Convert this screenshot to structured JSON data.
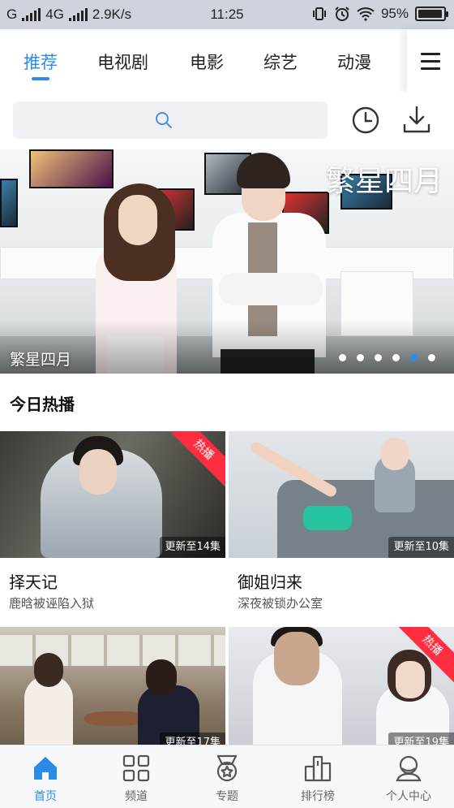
{
  "status_bar": {
    "carrier_g": "G",
    "network": "4G",
    "speed": "2.9K/s",
    "time": "11:25",
    "battery": "95%",
    "battery_level": 0.95
  },
  "top_tabs": [
    {
      "label": "推荐",
      "active": true
    },
    {
      "label": "电视剧",
      "active": false
    },
    {
      "label": "电影",
      "active": false
    },
    {
      "label": "综艺",
      "active": false
    },
    {
      "label": "动漫",
      "active": false
    }
  ],
  "search": {
    "placeholder": "",
    "value": ""
  },
  "banner": {
    "title_overlay": "繁星四月",
    "caption": "繁星四月",
    "slide_count": 6,
    "active_slide": 4
  },
  "section": {
    "title": "今日热播"
  },
  "cards": [
    {
      "title": "择天记",
      "subtitle": "鹿晗被诬陷入狱",
      "episodes": "更新至14集",
      "hot": true,
      "hot_label": "热播"
    },
    {
      "title": "御姐归来",
      "subtitle": "深夜被锁办公室",
      "episodes": "更新至10集",
      "hot": false,
      "hot_label": ""
    },
    {
      "title": "",
      "subtitle": "",
      "episodes": "更新至17集",
      "hot": false,
      "hot_label": ""
    },
    {
      "title": "",
      "subtitle": "",
      "episodes": "更新至19集",
      "hot": true,
      "hot_label": "热播"
    }
  ],
  "bottom_nav": [
    {
      "label": "首页",
      "icon": "home-icon",
      "active": true
    },
    {
      "label": "频道",
      "icon": "grid-icon",
      "active": false
    },
    {
      "label": "专题",
      "icon": "medal-icon",
      "active": false
    },
    {
      "label": "排行榜",
      "icon": "ranking-icon",
      "active": false
    },
    {
      "label": "个人中心",
      "icon": "profile-icon",
      "active": false
    }
  ],
  "colors": {
    "accent": "#2b8ce8",
    "hot_badge": "#ff2d3f",
    "status_bar": "#cfd3dc"
  }
}
